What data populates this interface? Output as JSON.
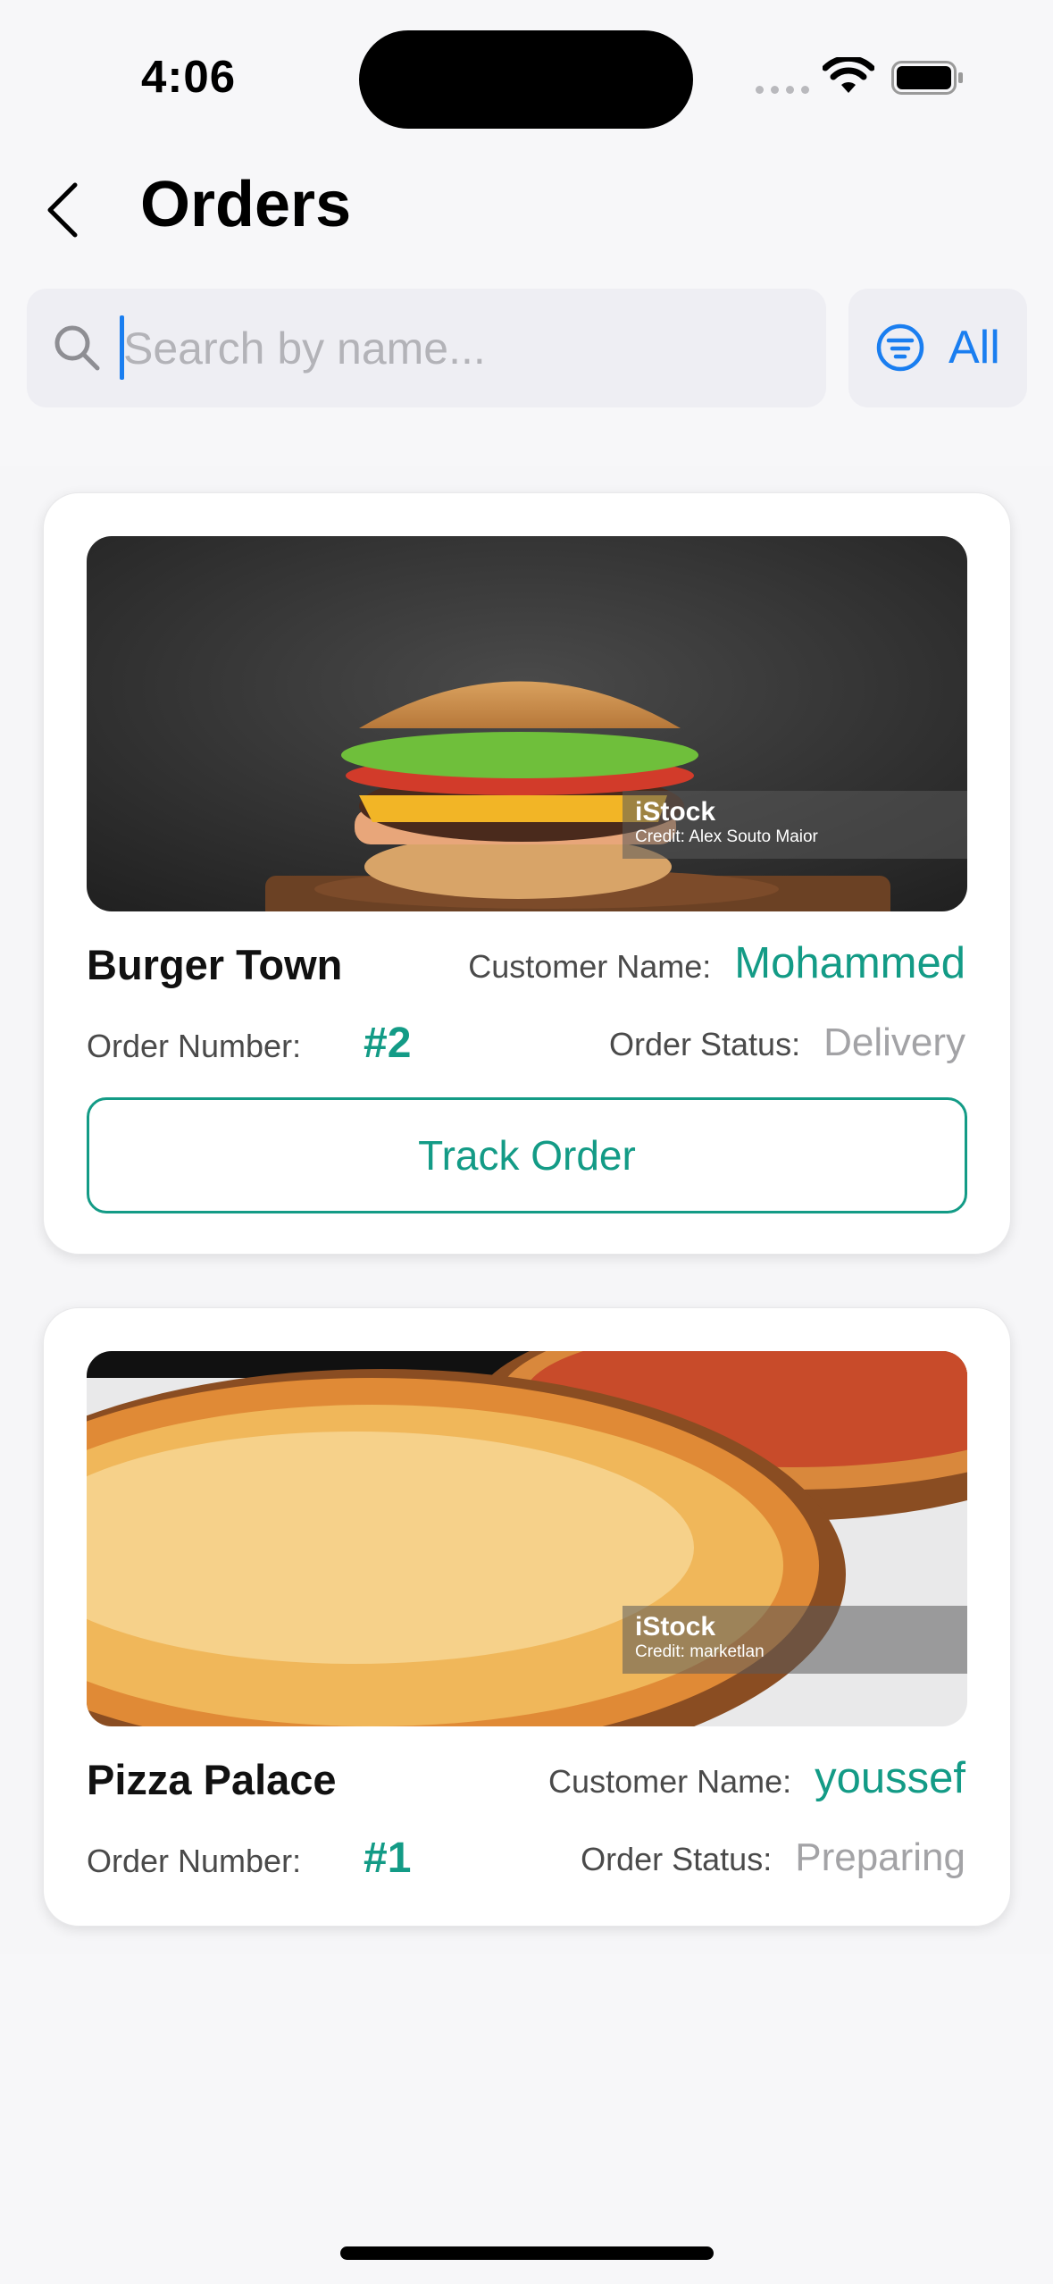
{
  "status_bar": {
    "time": "4:06"
  },
  "header": {
    "title": "Orders"
  },
  "search": {
    "placeholder": "Search by name...",
    "value": ""
  },
  "filter": {
    "label": "All"
  },
  "labels": {
    "customer_name": "Customer Name:",
    "order_number": "Order Number:",
    "order_status": "Order Status:",
    "track_order": "Track Order"
  },
  "orders": [
    {
      "restaurant": "Burger Town",
      "customer": "Mohammed",
      "order_number": "#2",
      "status": "Delivery",
      "image": "burger-photo",
      "image_credit_brand": "iStock",
      "image_credit": "Credit: Alex Souto Maior",
      "show_track_button": true
    },
    {
      "restaurant": "Pizza Palace",
      "customer": "youssef",
      "order_number": "#1",
      "status": "Preparing",
      "image": "pizza-photo",
      "image_credit_brand": "iStock",
      "image_credit": "Credit: marketlan",
      "show_track_button": false
    }
  ],
  "colors": {
    "accent": "#139b86",
    "link": "#1a7ef0",
    "status_muted": "#a3a3a6"
  }
}
